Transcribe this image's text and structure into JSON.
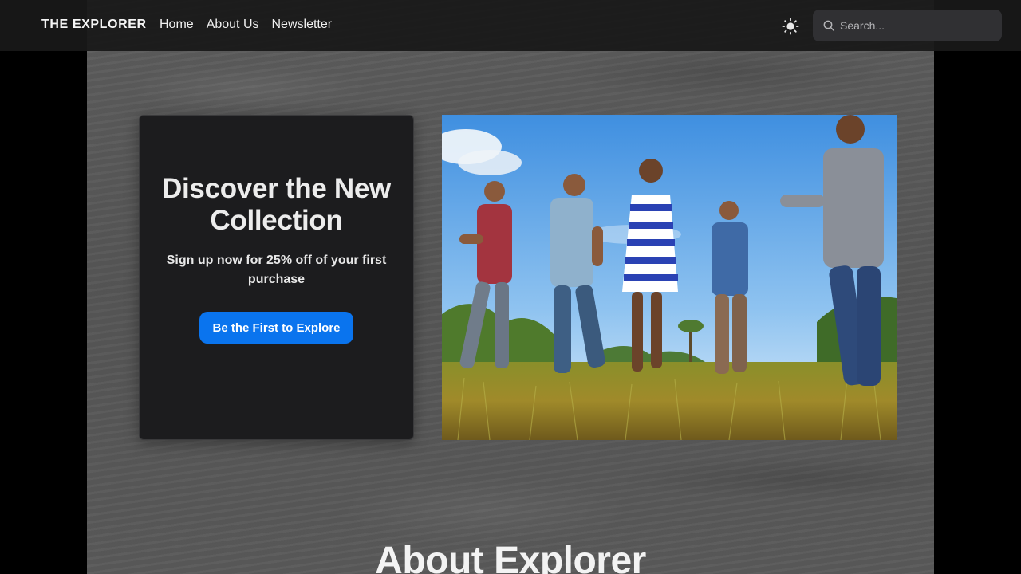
{
  "header": {
    "brand": "THE EXPLORER",
    "nav": [
      {
        "label": "Home"
      },
      {
        "label": "About Us"
      },
      {
        "label": "Newsletter"
      }
    ],
    "theme_toggle_icon": "sun-icon",
    "search": {
      "placeholder": "Search...",
      "value": "",
      "icon": "search-icon"
    }
  },
  "hero": {
    "title": "Discover the New Collection",
    "subtitle": "Sign up now for 25% off of your first purchase",
    "cta_label": "Be the First to Explore",
    "cta_color": "#0a74ee"
  },
  "about": {
    "heading": "About Explorer"
  },
  "colors": {
    "navbar": "#181818",
    "card": "#1c1c1e",
    "accent": "#0a74ee"
  }
}
